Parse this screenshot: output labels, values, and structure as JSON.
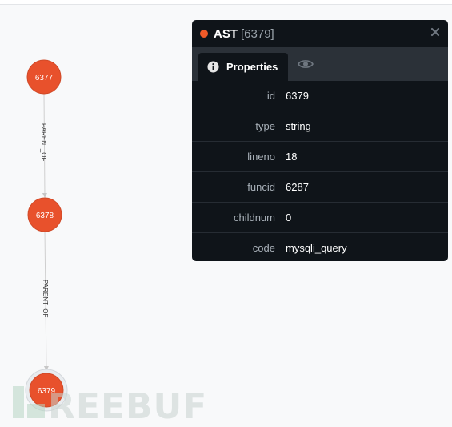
{
  "graph": {
    "nodes": [
      {
        "id": "n1",
        "label": "6377"
      },
      {
        "id": "n2",
        "label": "6378"
      },
      {
        "id": "n3",
        "label": "6379",
        "selected": true
      }
    ],
    "edges": [
      {
        "from": "n1",
        "to": "n2",
        "label": "PARENT_OF"
      },
      {
        "from": "n2",
        "to": "n3",
        "label": "PARENT_OF"
      }
    ],
    "node_color": "#e8512c"
  },
  "panel": {
    "status_color": "#f05a28",
    "title": "AST",
    "title_id": "[6379]",
    "close_icon": "close-icon",
    "tabs": {
      "properties_label": "Properties",
      "properties_icon": "info-icon",
      "second_icon": "eye-icon"
    },
    "properties": [
      {
        "key": "id",
        "value": "6379"
      },
      {
        "key": "type",
        "value": "string"
      },
      {
        "key": "lineno",
        "value": "18"
      },
      {
        "key": "funcid",
        "value": "6287"
      },
      {
        "key": "childnum",
        "value": "0"
      },
      {
        "key": "code",
        "value": "mysqli_query"
      }
    ]
  },
  "watermark": {
    "text": "REEBUF"
  }
}
